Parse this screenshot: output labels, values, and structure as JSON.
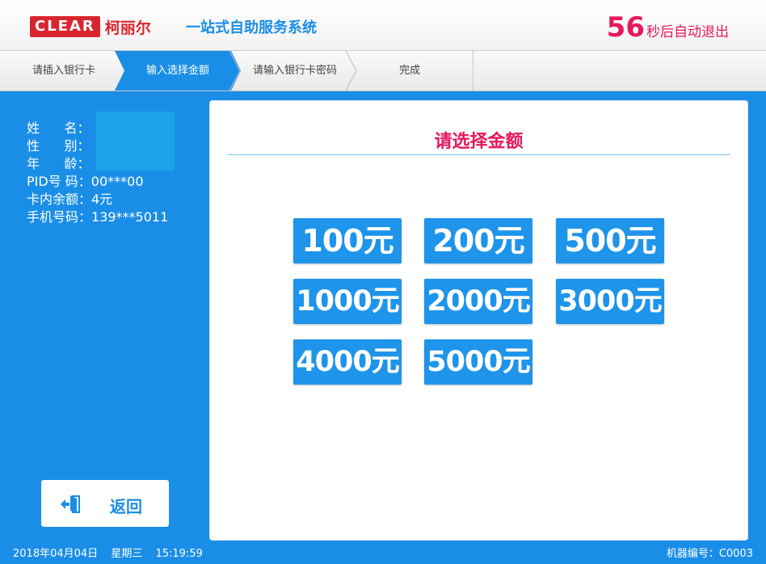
{
  "header": {
    "logo_text": "CLEAR",
    "logo_cn": "柯丽尔",
    "system_title": "一站式自助服务系统",
    "countdown_number": "56",
    "countdown_text": "秒后自动退出"
  },
  "steps": [
    {
      "label": "请插入银行卡",
      "active": false
    },
    {
      "label": "输入选择金额",
      "active": true
    },
    {
      "label": "请输入银行卡密码",
      "active": false
    },
    {
      "label": "完成",
      "active": false
    }
  ],
  "info": {
    "name_label": "姓      名：",
    "gender_label": "性      别：",
    "age_label": "年      龄：",
    "pid_label": "PID号 码：",
    "pid_value": "00***00",
    "balance_label": "卡内余额：",
    "balance_value": "4元",
    "phone_label": "手机号码：",
    "phone_value": "139***5011"
  },
  "back_button": {
    "label": "返回",
    "icon": "exit-door-icon"
  },
  "panel": {
    "title": "请选择金额",
    "amounts": [
      "100元",
      "200元",
      "500元",
      "1000元",
      "2000元",
      "3000元",
      "4000元",
      "5000元"
    ]
  },
  "footer": {
    "date": "2018年04月04日",
    "weekday": "星期三",
    "time": "15:19:59",
    "machine_label": "机器编号：C0003"
  },
  "colors": {
    "accent_blue": "#1a8ee6",
    "countdown_pink": "#e8175d",
    "logo_red": "#d8262f"
  }
}
